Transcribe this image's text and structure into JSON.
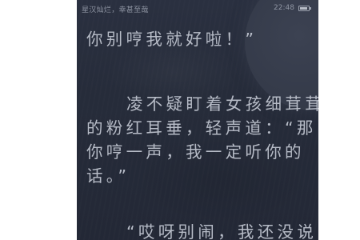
{
  "status_bar": {
    "title": "星汉灿烂，幸甚至哉",
    "time": "22:48",
    "battery_level": 0.85
  },
  "reader": {
    "lines": [
      "你别哼我就好啦！”",
      "凌不疑盯着女孩细茸茸",
      "的粉红耳垂，轻声道：“那",
      "你哼一声，我一定听你的",
      "话。”",
      "“哎呀别闹，我还没说"
    ]
  }
}
